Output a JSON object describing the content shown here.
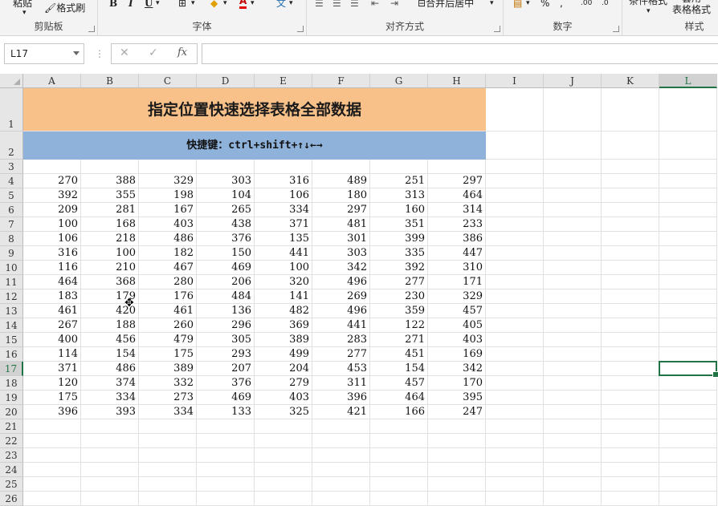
{
  "ribbon": {
    "clipboard": {
      "label": "剪贴板",
      "paste": "粘贴",
      "format_painter": "格式刷"
    },
    "font": {
      "label": "字体",
      "bold": "B",
      "italic": "I",
      "underline": "U"
    },
    "alignment": {
      "label": "对齐方式",
      "merge_center": "合并后居中"
    },
    "number": {
      "label": "数字",
      "percent": "%",
      "comma": ","
    },
    "styles": {
      "label": "样式",
      "conditional": "条件格式",
      "table_format": "套用\n表格格式"
    }
  },
  "formula_bar": {
    "name_box": "L17",
    "fx": "fx",
    "value": ""
  },
  "sheet": {
    "columns": [
      "A",
      "B",
      "C",
      "D",
      "E",
      "F",
      "G",
      "H",
      "I",
      "J",
      "K",
      "L"
    ],
    "rows": [
      "1",
      "2",
      "3",
      "4",
      "5",
      "6",
      "7",
      "8",
      "9",
      "10",
      "11",
      "12",
      "13",
      "14",
      "15",
      "16",
      "17",
      "18",
      "19",
      "20",
      "21",
      "22",
      "23",
      "24",
      "25",
      "26"
    ],
    "title": "指定位置快速选择表格全部数据",
    "subtitle": "快捷键：ctrl+shift+↑↓←→",
    "data": [
      [
        270,
        388,
        329,
        303,
        316,
        489,
        251,
        297
      ],
      [
        392,
        355,
        198,
        104,
        106,
        180,
        313,
        464
      ],
      [
        209,
        281,
        167,
        265,
        334,
        297,
        160,
        314
      ],
      [
        100,
        168,
        403,
        438,
        371,
        481,
        351,
        233
      ],
      [
        106,
        218,
        486,
        376,
        135,
        301,
        399,
        386
      ],
      [
        316,
        100,
        182,
        150,
        441,
        303,
        335,
        447
      ],
      [
        116,
        210,
        467,
        469,
        100,
        342,
        392,
        310
      ],
      [
        464,
        368,
        280,
        206,
        320,
        496,
        277,
        171
      ],
      [
        183,
        179,
        176,
        484,
        141,
        269,
        230,
        329
      ],
      [
        461,
        420,
        461,
        136,
        482,
        496,
        359,
        457
      ],
      [
        267,
        188,
        260,
        296,
        369,
        441,
        122,
        405
      ],
      [
        400,
        456,
        479,
        305,
        389,
        283,
        271,
        403
      ],
      [
        114,
        154,
        175,
        293,
        499,
        277,
        451,
        169
      ],
      [
        371,
        486,
        389,
        207,
        204,
        453,
        154,
        342
      ],
      [
        120,
        374,
        332,
        376,
        279,
        311,
        457,
        170
      ],
      [
        175,
        334,
        273,
        469,
        403,
        396,
        464,
        395
      ],
      [
        396,
        393,
        334,
        133,
        325,
        421,
        166,
        247
      ]
    ],
    "selected_cell": "L17"
  }
}
